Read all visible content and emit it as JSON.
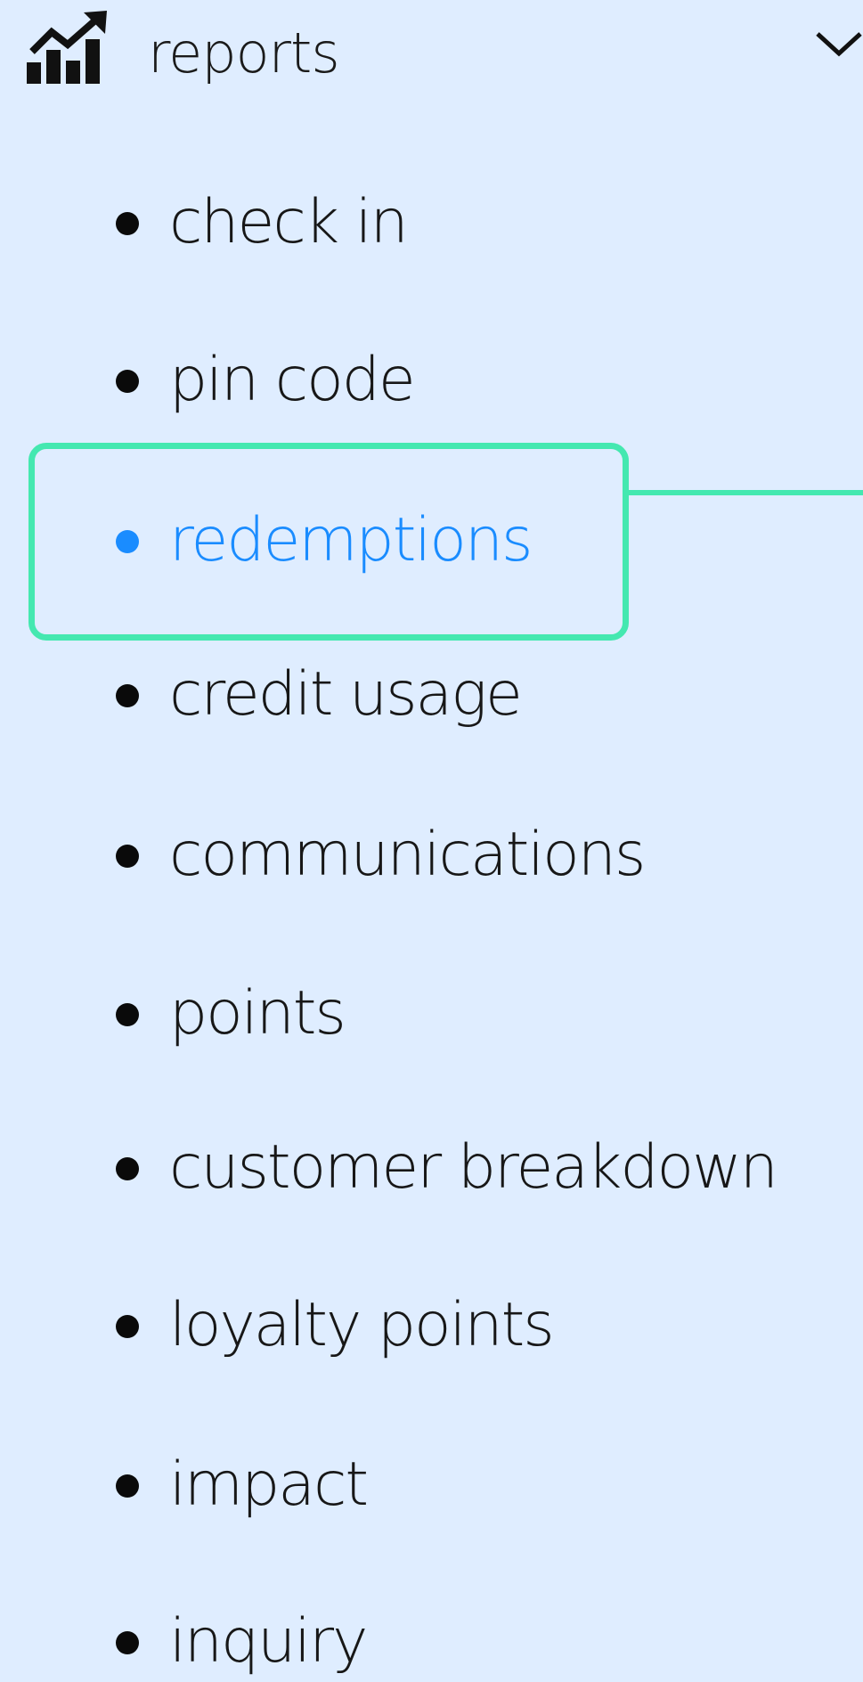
{
  "header": {
    "label": "reports",
    "icon": "chart-trend-icon",
    "toggle_icon": "chevron-down-icon"
  },
  "menu": {
    "items": [
      {
        "label": "check in",
        "active": false
      },
      {
        "label": "pin code",
        "active": false
      },
      {
        "label": "redemptions",
        "active": true
      },
      {
        "label": "credit usage",
        "active": false
      },
      {
        "label": "communications",
        "active": false
      },
      {
        "label": "points",
        "active": false
      },
      {
        "label": "customer breakdown",
        "active": false
      },
      {
        "label": "loyalty points",
        "active": false
      },
      {
        "label": "impact",
        "active": false
      },
      {
        "label": "inquiry",
        "active": false
      }
    ]
  },
  "colors": {
    "background": "#dfedff",
    "active": "#1a8cff",
    "highlight": "#44e8b0",
    "text": "#171717"
  }
}
